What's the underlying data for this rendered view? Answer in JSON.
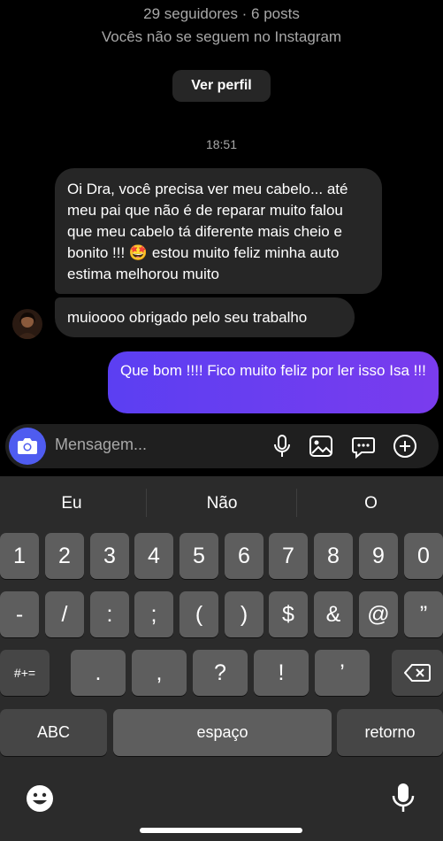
{
  "profile": {
    "stats": "29 seguidores · 6 posts",
    "relation": "Vocês não se seguem no Instagram",
    "view_profile_label": "Ver perfil"
  },
  "chat": {
    "time": "18:51",
    "messages_in": [
      "Oi Dra, você precisa ver meu cabelo... até meu pai que não é de reparar muito falou que meu cabelo tá diferente mais cheio e bonito !!! 🤩 estou muito feliz minha auto estima melhorou muito",
      "muioooo obrigado pelo seu trabalho"
    ],
    "message_out": "Que bom !!!! Fico muito feliz por ler isso Isa !!!"
  },
  "composer": {
    "placeholder": "Mensagem...",
    "icons": [
      "camera-icon",
      "microphone-icon",
      "image-icon",
      "sticker-icon",
      "plus-icon"
    ]
  },
  "keyboard": {
    "suggestions": [
      "Eu",
      "Não",
      "O"
    ],
    "row1": [
      "1",
      "2",
      "3",
      "4",
      "5",
      "6",
      "7",
      "8",
      "9",
      "0"
    ],
    "row2": [
      "-",
      "/",
      ":",
      ";",
      "(",
      ")",
      "$",
      "&",
      "@",
      "”"
    ],
    "row3": [
      "#+=",
      ".",
      ",",
      "?",
      "!",
      "’"
    ],
    "abc": "ABC",
    "space": "espaço",
    "return": "retorno"
  }
}
